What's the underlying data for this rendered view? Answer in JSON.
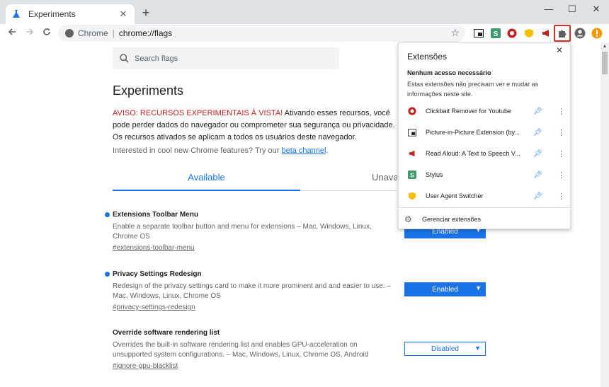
{
  "tab": {
    "title": "Experiments"
  },
  "window": {
    "minimize": "—",
    "maximize": "☐",
    "close": "✕"
  },
  "address": {
    "scheme": "Chrome",
    "separator": "|",
    "url": "chrome://flags"
  },
  "search": {
    "placeholder": "Search flags"
  },
  "page": {
    "title": "Experiments",
    "warning_red": "AVISO: RECURSOS EXPERIMENTAIS À VISTA!",
    "warning_rest": " Ativando esses recursos, você pode perder dados do navegador ou comprometer sua segurança ou privacidade. Os recursos ativados se aplicam a todos os usuários deste navegador.",
    "interested_text": "Interested in cool new Chrome features? Try our ",
    "beta_link": "beta channel",
    "interested_end": "."
  },
  "tabs": {
    "available": "Available",
    "unavailable": "Unavailable"
  },
  "flags": [
    {
      "name": "Extensions Toolbar Menu",
      "desc": "Enable a separate toolbar button and menu for extensions – Mac, Windows, Linux, Chrome OS",
      "link": "#extensions-toolbar-menu",
      "value": "Enabled"
    },
    {
      "name": "Privacy Settings Redesign",
      "desc": "Redesign of the privacy settings card to make it more prominent and and easier to use. – Mac, Windows, Linux, Chrome OS",
      "link": "#privacy-settings-redesign",
      "value": "Enabled"
    },
    {
      "name": "Override software rendering list",
      "desc": "Overrides the built-in software rendering list and enables GPU-acceleration on unsupported system configurations. – Mac, Windows, Linux, Chrome OS, Android",
      "link": "#ignore-gpu-blacklist",
      "value": "Disabled"
    }
  ],
  "extensions_popup": {
    "title": "Extensões",
    "section": "Nenhum acesso necessário",
    "description": "Estas extensões não precisam ver e mudar as informações neste site.",
    "items": [
      {
        "name": "Clickbait Remover for Youtube",
        "icon": "clickbait-icon"
      },
      {
        "name": "Picture-in-Picture Extension (by...",
        "icon": "pip-icon"
      },
      {
        "name": "Read Aloud: A Text to Speech V...",
        "icon": "megaphone-icon"
      },
      {
        "name": "Stylus",
        "icon": "stylus-icon"
      },
      {
        "name": "User Agent Switcher",
        "icon": "shield-icon"
      }
    ],
    "manage": "Gerenciar extensões"
  },
  "colors": {
    "accent": "#1a73e8",
    "warning": "#c5221f",
    "highlight": "#d93025"
  }
}
